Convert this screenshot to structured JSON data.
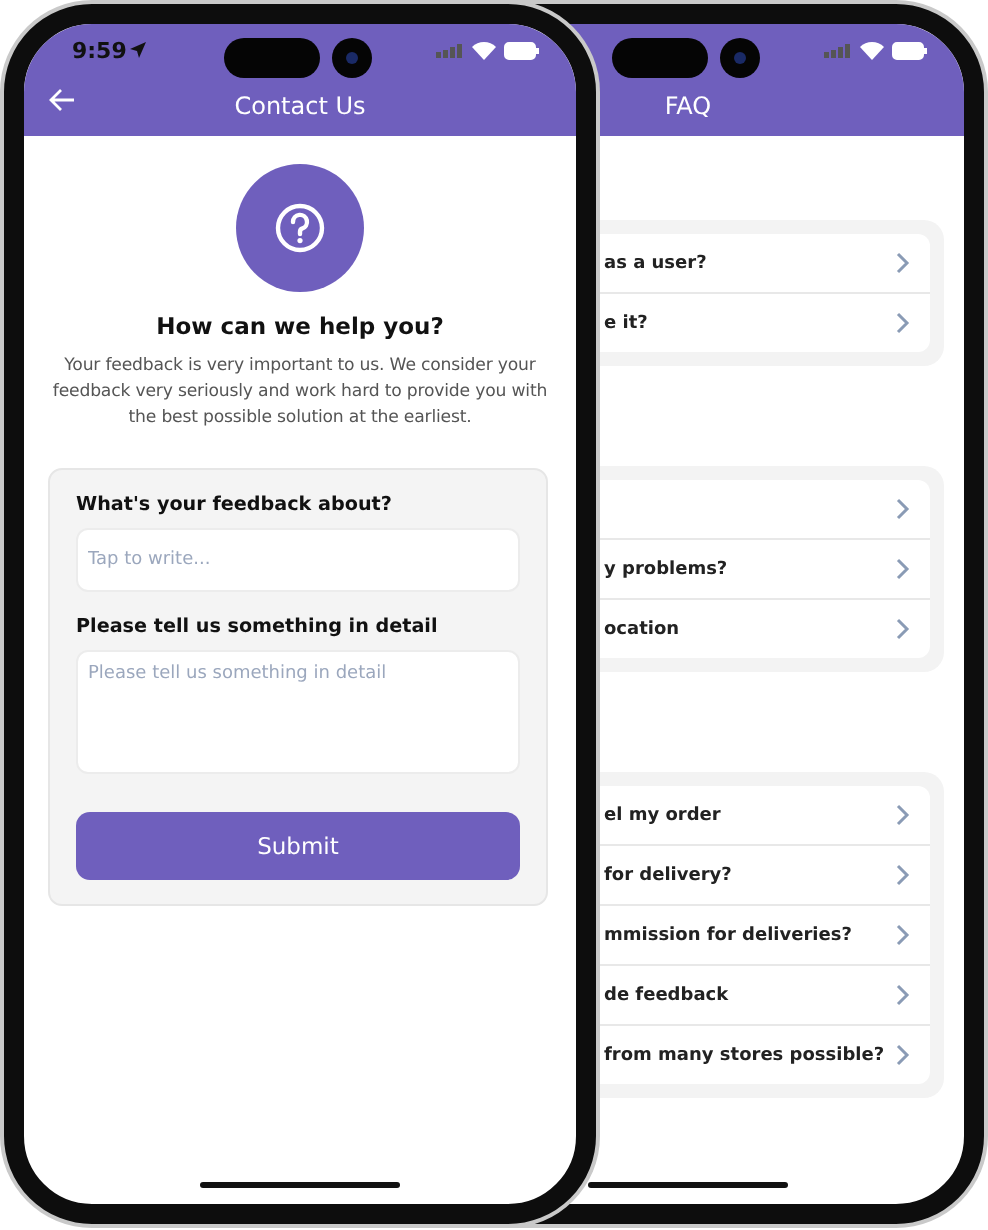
{
  "contact_screen": {
    "status_bar": {
      "time": "9:59"
    },
    "header": {
      "title": "Contact Us"
    },
    "heading": "How can we help you?",
    "intro": "Your feedback is very important to us. We consider your feedback very seriously and work hard to provide you with the best possible solution at the earliest.",
    "form": {
      "fields": [
        {
          "kind": "input",
          "label": "What's your feedback about?",
          "placeholder": "Tap to write..."
        },
        {
          "kind": "textarea",
          "label": "Please tell us something in detail",
          "placeholder": "Please tell us something in detail"
        }
      ],
      "submit": "Submit"
    }
  },
  "faq_screen": {
    "header": {
      "title": "FAQ"
    },
    "groups": [
      {
        "rows": [
          {
            "question": "as a user?"
          },
          {
            "question": "e it?"
          }
        ]
      },
      {
        "rows": [
          {},
          {
            "question": "y problems?"
          },
          {
            "question": "ocation"
          }
        ]
      },
      {
        "rows": [
          {
            "question": "el my order"
          },
          {
            "question": "for delivery?"
          },
          {
            "question": "mmission for deliveries?"
          },
          {
            "question": "de feedback"
          },
          {
            "question": "from many stores possible?"
          }
        ]
      }
    ]
  }
}
